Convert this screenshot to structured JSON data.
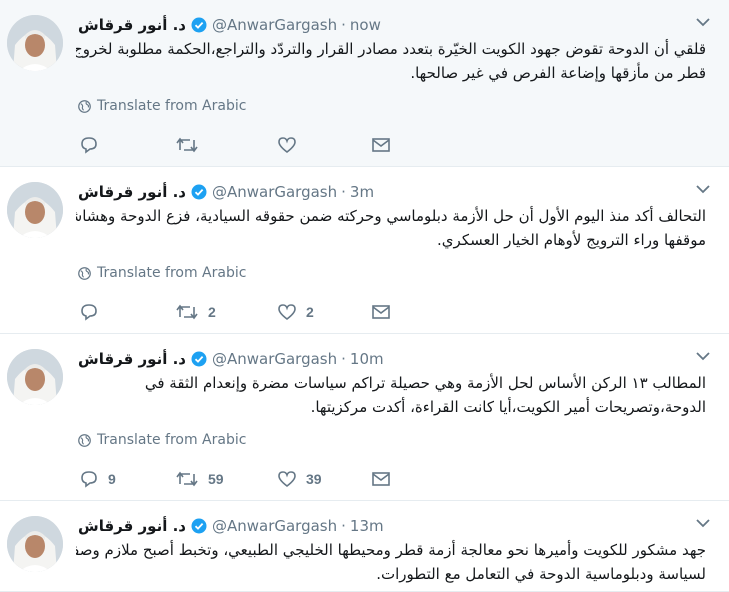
{
  "tweets": [
    {
      "name": "د. أنور قرقاش",
      "handle": "@AnwarGargash",
      "separator": "·",
      "time": "now",
      "lines": [
        "قلقي أن الدوحة تقوض جهود الكويت الخيّرة بتعدد مصادر القرار والتردّد والتراجع،الحكمة مطلوبة لخروج",
        "قطر من مأزقها وإضاعة الفرص في غير صالحها."
      ],
      "translate_label": "Translate from Arabic",
      "replies": "",
      "retweets": "",
      "likes": ""
    },
    {
      "name": "د. أنور قرقاش",
      "handle": "@AnwarGargash",
      "separator": "·",
      "time": "3m",
      "lines": [
        "التحالف أكد منذ اليوم الأول أن حل الأزمة دبلوماسي وحركته ضمن حقوقه السيادية، فزع الدوحة وهشاشة",
        "موقفها وراء الترويج لأوهام الخيار العسكري."
      ],
      "translate_label": "Translate from Arabic",
      "replies": "",
      "retweets": "2",
      "likes": "2"
    },
    {
      "name": "د. أنور قرقاش",
      "handle": "@AnwarGargash",
      "separator": "·",
      "time": "10m",
      "lines": [
        "المطالب ١٣ الركن الأساس لحل الأزمة وهي حصيلة تراكم سياسات مضرة وإنعدام الثقة في",
        "الدوحة،وتصريحات أمير الكويت،أيا كانت القراءة، أكدت مركزيتها."
      ],
      "translate_label": "Translate from Arabic",
      "replies": "9",
      "retweets": "59",
      "likes": "39"
    },
    {
      "name": "د. أنور قرقاش",
      "handle": "@AnwarGargash",
      "separator": "·",
      "time": "13m",
      "lines": [
        "جهد مشكور للكويت وأميرها نحو معالجة أزمة قطر ومحيطها الخليجي الطبيعي، وتخبط أصبح ملازم وصفة",
        "لسياسة ودبلوماسية الدوحة في التعامل مع التطورات."
      ],
      "translate_label": "",
      "replies": "",
      "retweets": "",
      "likes": ""
    }
  ],
  "icons": {
    "verified": "verified-badge-icon",
    "globe": "globe-icon",
    "reply": "reply-icon",
    "retweet": "retweet-icon",
    "like": "heart-icon",
    "dm": "envelope-icon",
    "caret": "chevron-down-icon"
  },
  "colors": {
    "highlight_bg": "#f5f8fa",
    "text": "#14171a",
    "secondary": "#657786",
    "verified": "#1da1f2",
    "divider": "#e6ecf0"
  }
}
